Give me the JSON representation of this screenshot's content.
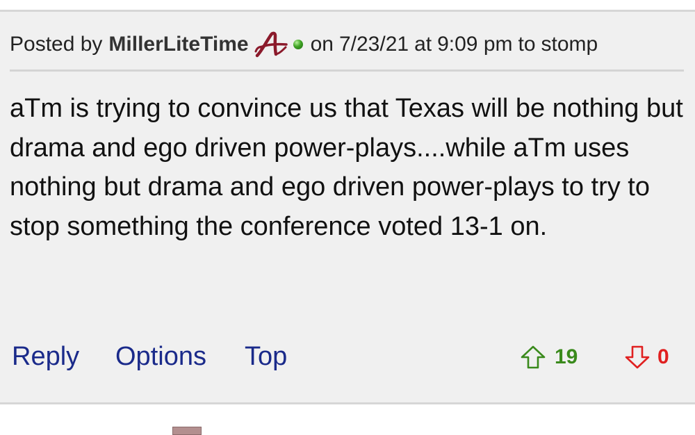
{
  "post": {
    "posted_by_label": "Posted by",
    "author": "MillerLiteTime",
    "team_logo_icon": "alabama-script-a-icon",
    "status_icon": "online-status-dot-icon",
    "on_label": "on",
    "date": "7/23/21",
    "at_label": "at",
    "time": "9:09 pm",
    "to_label": "to",
    "reply_to": "stomp",
    "body": "aTm is trying to convince us that Texas will be nothing but drama and ego driven power-plays....while aTm uses nothing but drama and ego driven power-plays to try to stop something the conference voted 13-1 on."
  },
  "actions": {
    "reply": "Reply",
    "options": "Options",
    "top": "Top",
    "upvote_icon": "thumbs-up-arrow-icon",
    "upvotes": "19",
    "downvote_icon": "thumbs-down-arrow-icon",
    "downvotes": "0"
  },
  "colors": {
    "link": "#1a2a8a",
    "upvote": "#3a8a1c",
    "downvote": "#e02020",
    "logo": "#8b1a2b",
    "card_bg": "#f0f0f0"
  }
}
